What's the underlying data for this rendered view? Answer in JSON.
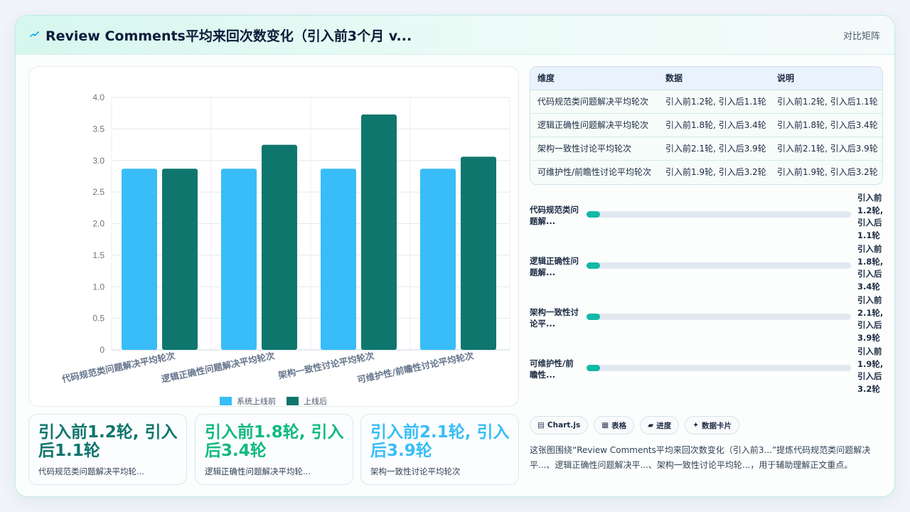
{
  "header": {
    "title": "Review Comments平均来回次数变化（引入前3个月 v...",
    "tag": "对比矩阵",
    "logo_icon": "pulse-icon"
  },
  "colors": {
    "series_before": "#38bdf8",
    "series_after": "#0f766e",
    "accent_teal": "#14b8a6",
    "stat_1": "#0f766e",
    "stat_2": "#10b981",
    "stat_3": "#38bdf8"
  },
  "chart_data": {
    "type": "bar",
    "categories": [
      "代码规范类问题解决平均轮次",
      "逻辑正确性问题解决平均轮次",
      "架构一致性讨论平均轮次",
      "可维护性/前瞻性讨论平均轮次"
    ],
    "series": [
      {
        "name": "系统上线前",
        "values": [
          2.87,
          2.87,
          2.87,
          2.87
        ]
      },
      {
        "name": "上线后",
        "values": [
          2.87,
          3.25,
          3.73,
          3.06
        ]
      }
    ],
    "yticks": [
      "0",
      "0.5",
      "1.0",
      "1.5",
      "2.0",
      "2.5",
      "3.0",
      "3.5",
      "4.0"
    ],
    "ylim": [
      0,
      4
    ],
    "legend_position": "bottom",
    "grid": true
  },
  "table": {
    "headers": [
      "维度",
      "数据",
      "说明"
    ],
    "rows": [
      [
        "代码规范类问题解决平均轮次",
        "引入前1.2轮, 引入后1.1轮",
        "引入前1.2轮, 引入后1.1轮"
      ],
      [
        "逻辑正确性问题解决平均轮次",
        "引入前1.8轮, 引入后3.4轮",
        "引入前1.8轮, 引入后3.4轮"
      ],
      [
        "架构一致性讨论平均轮次",
        "引入前2.1轮, 引入后3.9轮",
        "引入前2.1轮, 引入后3.9轮"
      ],
      [
        "可维护性/前瞻性讨论平均轮次",
        "引入前1.9轮, 引入后3.2轮",
        "引入前1.9轮, 引入后3.2轮"
      ]
    ]
  },
  "progress": [
    {
      "label_l1": "代码规范类问",
      "label_l2": "题解...",
      "v1": "引入前",
      "v2": "1.2轮,",
      "v3": "引入后",
      "v4": "1.1轮",
      "fraction": 0.05
    },
    {
      "label_l1": "逻辑正确性问",
      "label_l2": "题解...",
      "v1": "引入前",
      "v2": "1.8轮,",
      "v3": "引入后",
      "v4": "3.4轮",
      "fraction": 0.05
    },
    {
      "label_l1": "架构一致性讨",
      "label_l2": "论平...",
      "v1": "引入前",
      "v2": "2.1轮,",
      "v3": "引入后",
      "v4": "3.9轮",
      "fraction": 0.05
    },
    {
      "label_l1": "可维护性/前",
      "label_l2": "瞻性...",
      "v1": "引入前",
      "v2": "1.9轮,",
      "v3": "引入后",
      "v4": "3.2轮",
      "fraction": 0.05
    }
  ],
  "stats": [
    {
      "value": "引入前1.2轮, 引入后1.1轮",
      "label": "代码规范类问题解决平均轮..."
    },
    {
      "value": "引入前1.8轮, 引入后3.4轮",
      "label": "逻辑正确性问题解决平均轮..."
    },
    {
      "value": "引入前2.1轮, 引入后3.9轮",
      "label": "架构一致性讨论平均轮次"
    }
  ],
  "chips": [
    {
      "icon": "▤",
      "label": "Chart.js"
    },
    {
      "icon": "▦",
      "label": "表格"
    },
    {
      "icon": "▰",
      "label": "进度"
    },
    {
      "icon": "✦",
      "label": "数据卡片"
    }
  ],
  "description": "这张图围绕“Review Comments平均来回次数变化（引入前3...”提炼代码规范类问题解决平...、逻辑正确性问题解决平...、架构一致性讨论平均轮...，用于辅助理解正文重点。"
}
